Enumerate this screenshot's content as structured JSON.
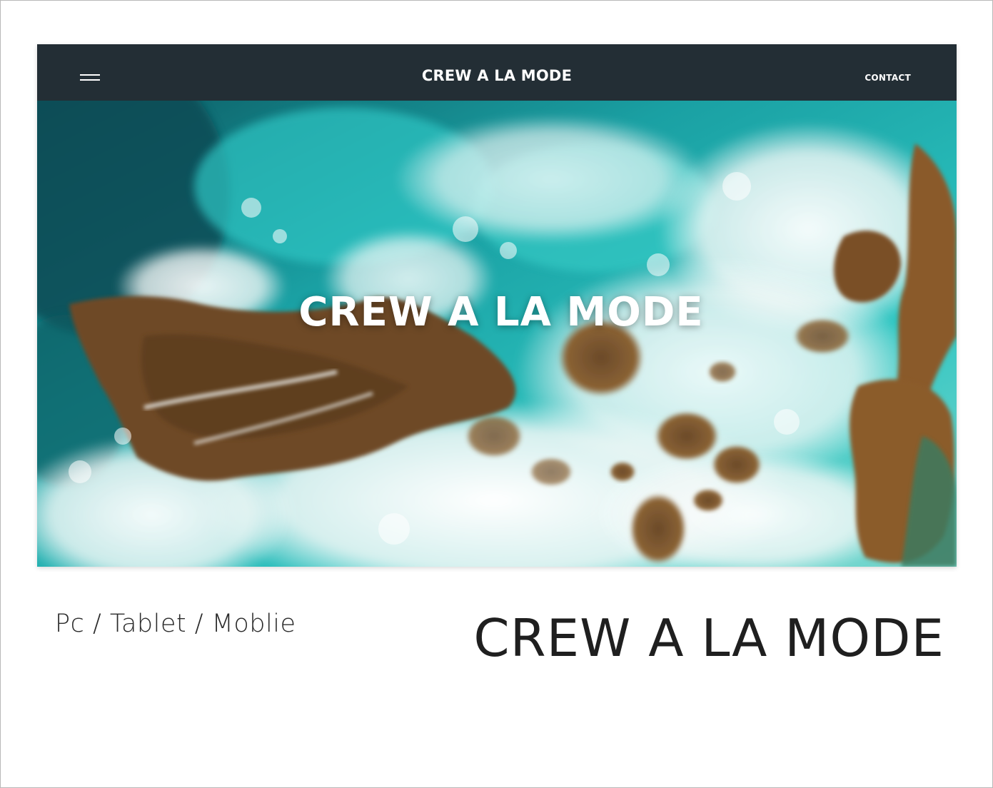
{
  "site": {
    "navbar": {
      "brand": "CREW A LA MODE",
      "contact_label": "CONTACT",
      "menu_icon": "hamburger-menu-icon",
      "background_color": "#232e35"
    },
    "hero": {
      "title": "CREW A LA MODE",
      "image": "aerial-ocean-waves-on-rocky-coast"
    }
  },
  "captions": {
    "devices": "Pc / Tablet / Moblie",
    "brand": "CREW A LA MODE"
  }
}
